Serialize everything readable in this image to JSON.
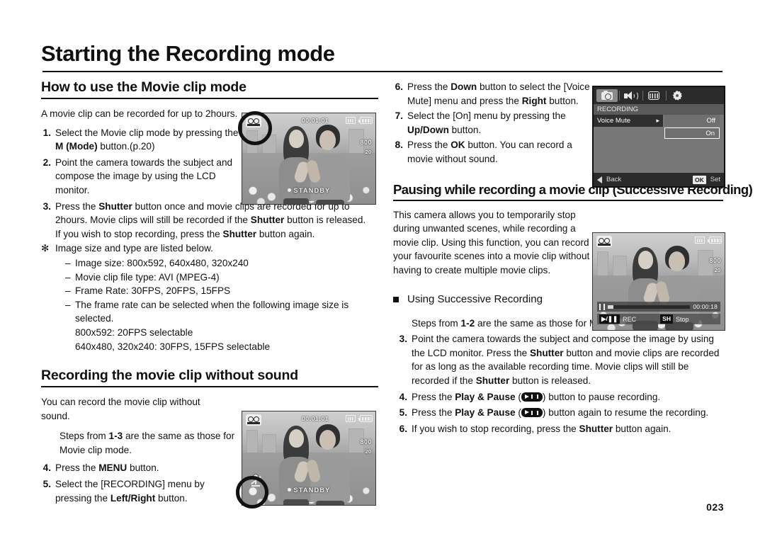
{
  "page": {
    "title": "Starting the Recording mode",
    "number": "023"
  },
  "left_column": {
    "section1": {
      "heading": "How to use the Movie clip mode",
      "intro": "A movie clip can be recorded for up to 2hours.",
      "steps": [
        {
          "num": "1.",
          "text_before": "Select the Movie clip mode by pressing the ",
          "bold": "M (Mode)",
          "text_after": " button.(p.20)"
        },
        {
          "num": "2.",
          "text_before": "Point the camera towards the subject and compose the image by using the LCD monitor.",
          "bold": "",
          "text_after": ""
        }
      ],
      "step3_num": "3.",
      "step3_a": "Press the ",
      "step3_b_shutter": "Shutter",
      "step3_c": " button once and movie clips are recorded for up to 2hours.  Movie clips will still be recorded if the ",
      "step3_d_shutter": "Shutter",
      "step3_e": " button is released.",
      "step3_f": "If you wish to stop recording, press the ",
      "step3_g_shutter": "Shutter",
      "step3_h": " button again.",
      "star_bullet": "✻",
      "star_text": "Image size and type are listed below.",
      "dashes": [
        "Image size: 800x592, 640x480, 320x240",
        "Movie clip file type: AVI (MPEG-4)",
        "Frame Rate: 30FPS, 20FPS, 15FPS",
        "The frame rate can be selected when the following image size is selected."
      ],
      "sub_lines": [
        "800x592: 20FPS selectable",
        "640x480, 320x240: 30FPS, 15FPS selectable"
      ]
    },
    "section2": {
      "heading": "Recording the movie clip without sound",
      "intro": "You can record the movie clip without sound.",
      "steps_note_a": "Steps from ",
      "steps_note_b": "1-3",
      "steps_note_c": " are the same as those for Movie clip mode.",
      "steps": [
        {
          "num": "4.",
          "a": "Press the ",
          "b": "MENU",
          "c": " button."
        },
        {
          "num": "5.",
          "a": "Select the [RECORDING] menu by pressing the ",
          "b": "Left/Right",
          "c": " button."
        }
      ]
    }
  },
  "right_column": {
    "steps_top": [
      {
        "num": "6.",
        "a": "Press the ",
        "b": "Down",
        "c": " button to select the [Voice Mute] menu and press the ",
        "b2": "Right",
        "d": " button."
      },
      {
        "num": "7.",
        "a": "Select the [On] menu by pressing the ",
        "b": "Up/Down",
        "c": " button."
      },
      {
        "num": "8.",
        "a": "Press the ",
        "b": "OK",
        "c": " button. You can record a movie without sound."
      }
    ],
    "section3": {
      "heading": "Pausing while recording a movie clip (Successive Recording)",
      "paragraph": "This camera allows you to temporarily stop during unwanted scenes, while recording a movie clip. Using this function, you can record your favourite scenes into a movie clip without having to create multiple movie clips.",
      "bullet_heading": "Using Successive Recording",
      "steps_note_a": "Steps from ",
      "steps_note_b": "1-2",
      "steps_note_c": " are the same as those for Movie clip mode.",
      "steps": [
        {
          "num": "3.",
          "a": "Point the camera towards the subject and compose the image by using the LCD monitor. Press the ",
          "b": "Shutter",
          "c": " button and movie clips are recorded for as long as the available recording time. Movie clips will still be recorded if the ",
          "b2": "Shutter",
          "d": " button is released."
        },
        {
          "num": "4.",
          "a": "Press the ",
          "b": "Play & Pause",
          "glyph": "play-pause-icon",
          "c": " button to pause recording."
        },
        {
          "num": "5.",
          "a": "Press the ",
          "b": "Play & Pause",
          "glyph": "play-pause-icon",
          "c": " button again to resume the recording."
        },
        {
          "num": "6.",
          "a": "If you wish to stop recording, press the ",
          "b": "Shutter",
          "c": " button again."
        }
      ]
    }
  },
  "menu_screenshot": {
    "tabs": [
      "camera-icon",
      "sound-icon",
      "display-icon",
      "setup-gear-icon"
    ],
    "active_tab_index": 0,
    "title": "RECORDING",
    "row_label": "Voice Mute",
    "row_arrow": "▸",
    "options": [
      "Off",
      "On"
    ],
    "selected_option": "On",
    "footer_back": "Back",
    "footer_ok_key": "OK",
    "footer_set": "Set"
  },
  "lcd_panels": {
    "movie_standby_top": {
      "time": "00:01:01",
      "resolution": "800",
      "fps": "20",
      "status": "STANDBY",
      "icons": [
        "movie-mode-icon",
        "memory-card-icon",
        "battery-icon"
      ]
    },
    "movie_standby_bottom": {
      "time": "00:01:01",
      "resolution": "800",
      "fps": "20",
      "status": "STANDBY",
      "icons": [
        "movie-mode-icon",
        "memory-card-icon",
        "battery-icon",
        "voice-mute-icon"
      ]
    },
    "successive_recording": {
      "elapsed": "00:00:18",
      "resolution": "800",
      "fps": "20",
      "rec_label": "REC",
      "stop_key": "SH",
      "stop_label": "Stop",
      "icons": [
        "movie-mode-icon",
        "memory-card-icon",
        "battery-icon",
        "pause-icon",
        "play-pause-icon"
      ]
    }
  },
  "colors": {
    "ink": "#111111",
    "menu_dark": "#2b2b2b",
    "menu_mid": "#5a5a5a",
    "menu_light": "#777777",
    "highlight": "#ffffff"
  }
}
